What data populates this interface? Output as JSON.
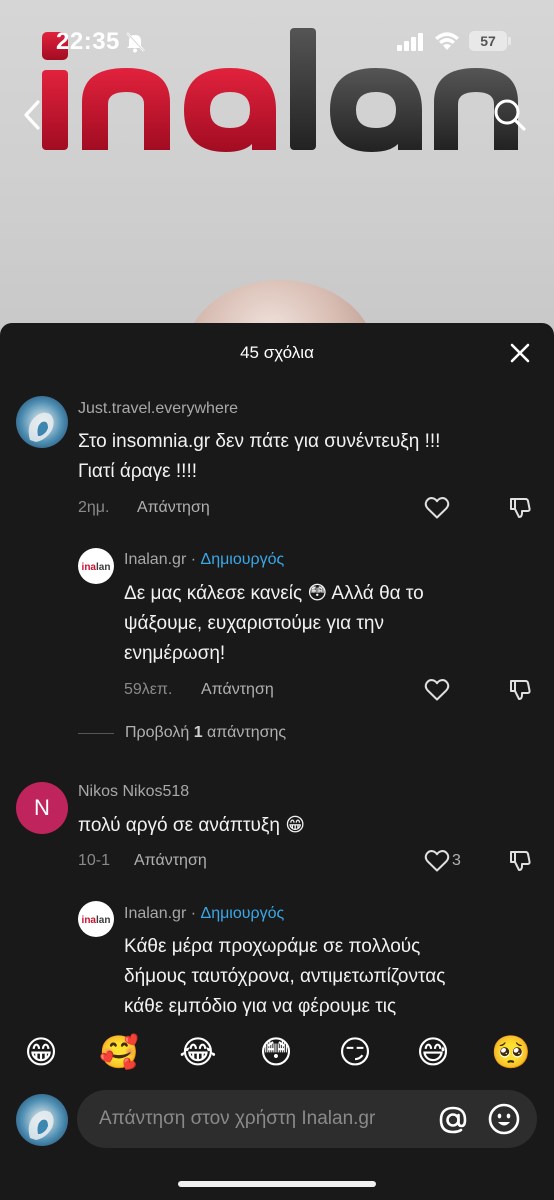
{
  "status_bar": {
    "time": "22:35",
    "battery": "57"
  },
  "video": {
    "logo_text": "inalan"
  },
  "sheet": {
    "title": "45 σχόλια"
  },
  "comments": [
    {
      "username": "Just.travel.everywhere",
      "text_line1": "Στο insomnia.gr δεν πάτε για συνέντευξη !!!",
      "text_line2": "Γιατί άραγε !!!!",
      "time": "2ημ.",
      "reply_label": "Απάντηση"
    },
    {
      "username": "Inalan.gr",
      "separator": "·",
      "badge": "Δημιουργός",
      "text_line1": "Δε μας κάλεσε κανείς 😳 Αλλά θα το",
      "text_line2": "ψάξουμε, ευχαριστούμε για την",
      "text_line3": "ενημέρωση!",
      "time": "59λεπ.",
      "reply_label": "Απάντηση"
    },
    {
      "username": "Nikos Nikos518",
      "avatar_letter": "N",
      "text_line1": "πολύ αργό σε ανάπτυξη 😁",
      "time": "10-1",
      "reply_label": "Απάντηση",
      "likes": "3"
    },
    {
      "username": "Inalan.gr",
      "separator": "·",
      "badge": "Δημιουργός",
      "text_line1": "Κάθε μέρα προχωράμε σε πολλούς",
      "text_line2": "δήμους ταυτόχρονα, αντιμετωπίζοντας",
      "text_line3": "κάθε εμπόδιο για να φέρουμε τις"
    }
  ],
  "view_replies": {
    "prefix": "Προβολή ",
    "count": "1",
    "suffix": " απάντησης"
  },
  "quick_emojis": [
    "😁",
    "🥰",
    "😂",
    "😳",
    "😏",
    "😅",
    "🥺"
  ],
  "reply_input": {
    "placeholder": "Απάντηση στον χρήστη Inalan.gr"
  },
  "colors": {
    "logo_red": "#c8102e",
    "logo_gray": "#3a3a3a",
    "creator_blue": "#3aa7e6",
    "avatar_pink": "#c0245c"
  }
}
